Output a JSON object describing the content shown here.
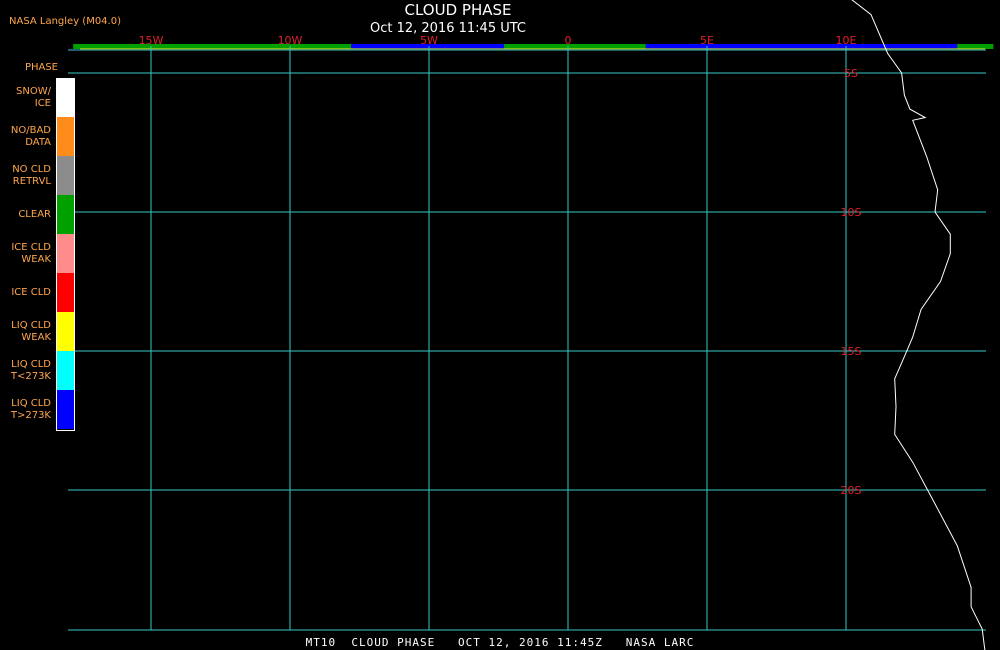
{
  "header": {
    "attribution": "NASA Langley (M04.0)",
    "title": "CLOUD PHASE",
    "subtitle": "Oct 12, 2016 11:45 UTC"
  },
  "footer": {
    "text": "MT10  CLOUD PHASE   OCT 12, 2016 11:45Z   NASA LARC"
  },
  "legend": {
    "header": "PHASE",
    "items": [
      {
        "label": "SNOW/\nICE",
        "color": "#ffffff"
      },
      {
        "label": "NO/BAD\nDATA",
        "color": "#ff8c1a"
      },
      {
        "label": "NO CLD\nRETRVL",
        "color": "#8c8c8c"
      },
      {
        "label": "CLEAR",
        "color": "#00a000"
      },
      {
        "label": "ICE CLD\nWEAK",
        "color": "#ff8c8c"
      },
      {
        "label": "ICE CLD",
        "color": "#ff0000"
      },
      {
        "label": "LIQ CLD\nWEAK",
        "color": "#ffff00"
      },
      {
        "label": "LIQ CLD\nT<273K",
        "color": "#00ffff"
      },
      {
        "label": "LIQ CLD\nT>273K",
        "color": "#0000ff"
      }
    ]
  },
  "map": {
    "gridline_color": "#35c8c8",
    "gridlabel_color": "#e0202a",
    "coastline_color": "#ffffff",
    "longitude_lines": [
      {
        "label": "15W",
        "lon": -15
      },
      {
        "label": "10W",
        "lon": -10
      },
      {
        "label": "5W",
        "lon": -5
      },
      {
        "label": "0",
        "lon": 0
      },
      {
        "label": "5E",
        "lon": 5
      },
      {
        "label": "10E",
        "lon": 10
      }
    ],
    "latitude_lines": [
      {
        "label": "5S",
        "lat": -5
      },
      {
        "label": "10S",
        "lat": -10
      },
      {
        "label": "15S",
        "lat": -15
      },
      {
        "label": "20S",
        "lat": -20
      }
    ],
    "coastline": [
      [
        10.0,
        -2.2
      ],
      [
        10.9,
        -2.9
      ],
      [
        11.5,
        -4.3
      ],
      [
        12.0,
        -5.0
      ],
      [
        12.1,
        -5.8
      ],
      [
        12.3,
        -6.3
      ],
      [
        12.85,
        -6.6
      ],
      [
        12.4,
        -6.7
      ],
      [
        12.9,
        -8.0
      ],
      [
        13.3,
        -9.2
      ],
      [
        13.2,
        -10.0
      ],
      [
        13.75,
        -10.8
      ],
      [
        13.75,
        -11.5
      ],
      [
        13.4,
        -12.5
      ],
      [
        12.7,
        -13.5
      ],
      [
        12.4,
        -14.5
      ],
      [
        12.1,
        -15.2
      ],
      [
        11.75,
        -16.0
      ],
      [
        11.8,
        -17.0
      ],
      [
        11.75,
        -18.0
      ],
      [
        12.4,
        -19.0
      ],
      [
        13.2,
        -20.5
      ],
      [
        14.0,
        -22.0
      ],
      [
        14.5,
        -23.5
      ],
      [
        14.5,
        -24.2
      ],
      [
        14.9,
        -25.0
      ],
      [
        15.0,
        -25.8
      ]
    ],
    "cloud_strip": [
      {
        "lon_start": -17.8,
        "lon_end": -7.8,
        "color": "#00a000"
      },
      {
        "lon_start": -7.8,
        "lon_end": -2.3,
        "color": "#0000ff"
      },
      {
        "lon_start": -2.3,
        "lon_end": 2.8,
        "color": "#00a000"
      },
      {
        "lon_start": 2.8,
        "lon_end": 9.6,
        "color": "#0000ff"
      },
      {
        "lon_start": 9.6,
        "lon_end": 14.0,
        "color": "#0000ff"
      },
      {
        "lon_start": 14.0,
        "lon_end": 15.3,
        "color": "#00a000"
      }
    ]
  }
}
